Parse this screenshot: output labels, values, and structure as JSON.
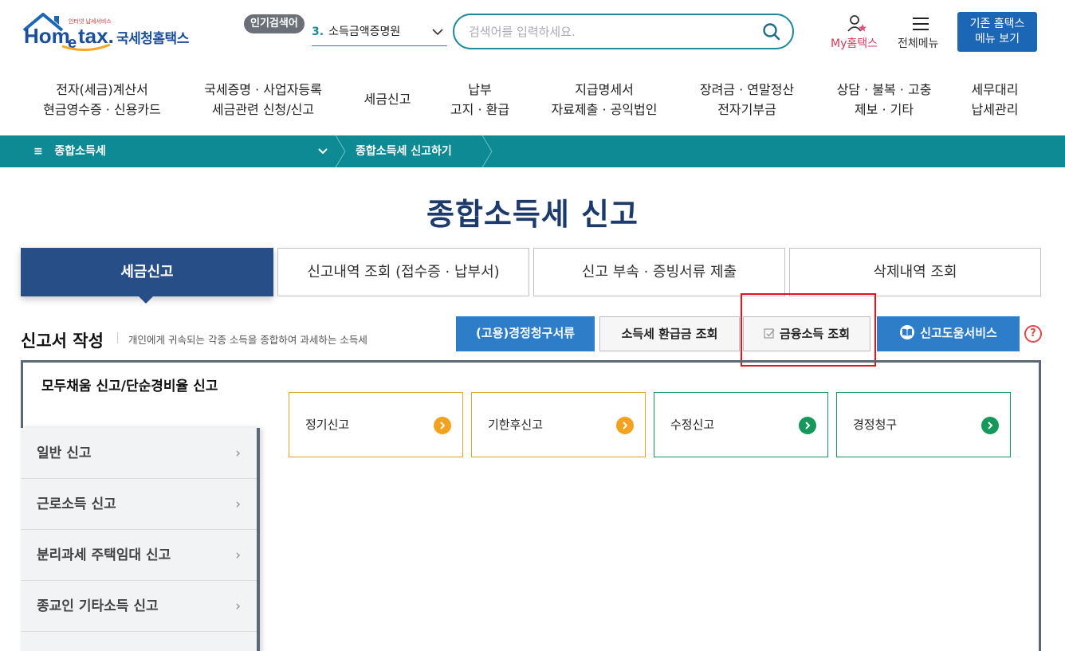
{
  "header": {
    "logo_text": "Hometax.",
    "logo_brand": "국세청홈택스",
    "logo_tagline": "인터넷 납세서비스",
    "popular_label": "인기검색어",
    "popular_rank": "3.",
    "popular_term": "소득금액증명원",
    "search_placeholder": "검색어를 입력하세요.",
    "my_hometax": "My홈택스",
    "all_menu": "전체메뉴",
    "old_hometax_line1": "기존 홈택스",
    "old_hometax_line2": "메뉴 보기"
  },
  "gnb": [
    {
      "line1": "전자(세금)계산서",
      "line2": "현금영수증 · 신용카드"
    },
    {
      "line1": "국세증명 · 사업자등록",
      "line2": "세금관련 신청/신고"
    },
    {
      "line1": "세금신고",
      "line2": ""
    },
    {
      "line1": "납부",
      "line2": "고지 · 환급"
    },
    {
      "line1": "지급명세서",
      "line2": "자료제출 · 공익법인"
    },
    {
      "line1": "장려금 · 연말정산",
      "line2": "전자기부금"
    },
    {
      "line1": "상담 · 불복 · 고충",
      "line2": "제보 · 기타"
    },
    {
      "line1": "세무대리",
      "line2": "납세관리"
    }
  ],
  "breadcrumb": {
    "menu_icon": "≡",
    "category": "종합소득세",
    "current": "종합소득세 신고하기"
  },
  "page_title": "종합소득세 신고",
  "tabs": [
    {
      "label": "세금신고",
      "active": true
    },
    {
      "label": "신고내역 조회 (접수증 · 납부서)",
      "active": false
    },
    {
      "label": "신고 부속 · 증빙서류 제출",
      "active": false
    },
    {
      "label": "삭제내역 조회",
      "active": false
    }
  ],
  "section": {
    "title": "신고서 작성",
    "description": "개인에게 귀속되는 각종 소득을 종합하여 과세하는 소득세"
  },
  "actions": {
    "claim_docs": "(고용)경정청구서류",
    "refund_lookup": "소득세 환급금 조회",
    "financial_income": "금융소득 조회",
    "help_service": "신고도움서비스",
    "help_icon": "?"
  },
  "sidebar": {
    "active_label": "모두채움 신고/단순경비율 신고",
    "items": [
      {
        "label": "일반 신고"
      },
      {
        "label": "근로소득 신고"
      },
      {
        "label": "분리과세 주택임대 신고"
      },
      {
        "label": "종교인 기타소득 신고"
      }
    ]
  },
  "cards": [
    {
      "label": "정기신고",
      "color": "#f3a21f"
    },
    {
      "label": "기한후신고",
      "color": "#f3a21f"
    },
    {
      "label": "수정신고",
      "color": "#16985a"
    },
    {
      "label": "경정청구",
      "color": "#16985a"
    }
  ]
}
